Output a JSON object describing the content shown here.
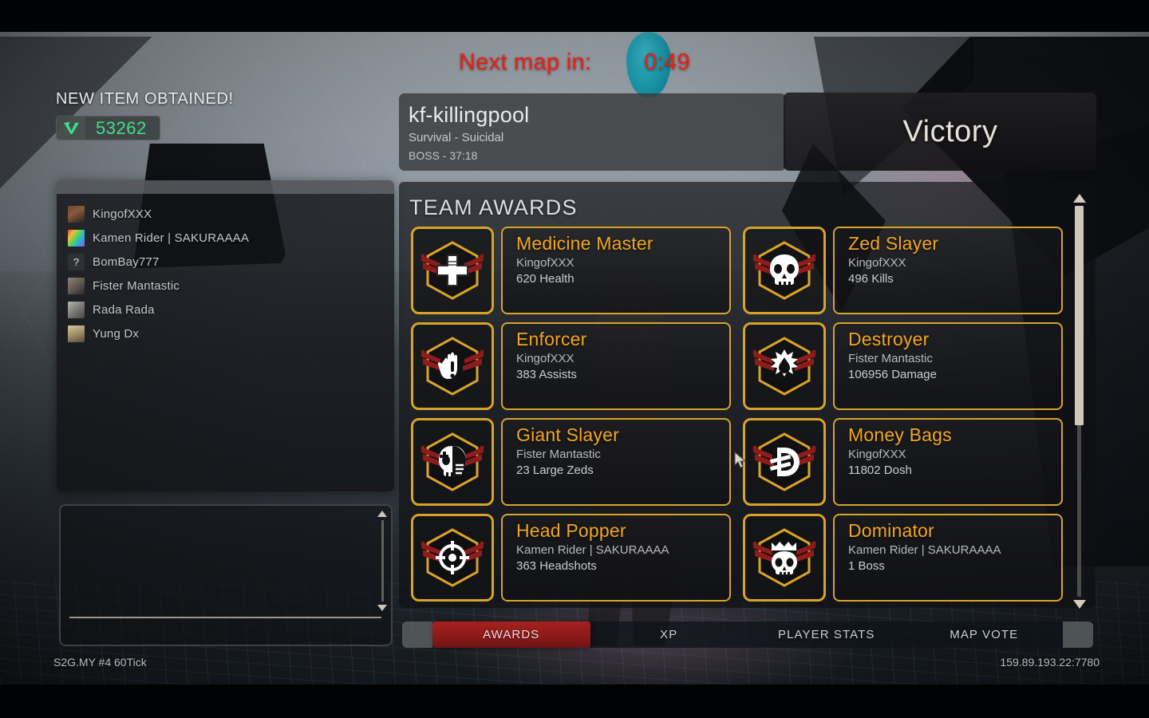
{
  "countdown": {
    "label": "Next map in:",
    "time": "0:49"
  },
  "new_item": {
    "title": "NEW ITEM OBTAINED!",
    "icon": "dosh-vault-icon",
    "value": "53262",
    "value_color": "#3ee08a"
  },
  "map_info": {
    "name": "kf-killingpool",
    "mode": "Survival - Suicidal",
    "wave": "BOSS - 37:18"
  },
  "result": {
    "text": "Victory"
  },
  "players": {
    "items": [
      {
        "name": "KingofXXX",
        "avatar": "avatar-thumbnail"
      },
      {
        "name": "Kamen Rider | SAKURAAAA",
        "avatar": "avatar-thumbnail"
      },
      {
        "name": "BomBay777",
        "avatar": "avatar-unknown-placeholder"
      },
      {
        "name": "Fister Mantastic",
        "avatar": "avatar-thumbnail"
      },
      {
        "name": "Rada Rada",
        "avatar": "avatar-thumbnail"
      },
      {
        "name": "Yung Dx",
        "avatar": "avatar-thumbnail"
      }
    ]
  },
  "awards": {
    "heading": "TEAM AWARDS",
    "accent_color": "#d9a22b",
    "name_color": "#f2a51f",
    "items": [
      {
        "name": "Medicine Master",
        "player": "KingofXXX",
        "stat": "620 Health",
        "icon": "medical-cross-icon"
      },
      {
        "name": "Zed Slayer",
        "player": "KingofXXX",
        "stat": "496 Kills",
        "icon": "skull-icon"
      },
      {
        "name": "Enforcer",
        "player": "KingofXXX",
        "stat": "383 Assists",
        "icon": "hand-exclamation-icon"
      },
      {
        "name": "Destroyer",
        "player": "Fister Mantastic",
        "stat": "106956 Damage",
        "icon": "explosion-droplet-icon"
      },
      {
        "name": "Giant Slayer",
        "player": "Fister Mantastic",
        "stat": "23 Large Zeds",
        "icon": "masked-skull-icon"
      },
      {
        "name": "Money Bags",
        "player": "KingofXXX",
        "stat": "11802 Dosh",
        "icon": "dosh-symbol-icon"
      },
      {
        "name": "Head Popper",
        "player": "Kamen Rider | SAKURAAAA",
        "stat": "363 Headshots",
        "icon": "crosshair-icon"
      },
      {
        "name": "Dominator",
        "player": "Kamen Rider | SAKURAAAA",
        "stat": "1 Boss",
        "icon": "crowned-skull-icon"
      }
    ]
  },
  "tabs": {
    "items": [
      {
        "label": "AWARDS",
        "active": true
      },
      {
        "label": "XP",
        "active": false
      },
      {
        "label": "PLAYER STATS",
        "active": false
      },
      {
        "label": "MAP VOTE",
        "active": false
      }
    ],
    "active_color": "#8c1a19"
  },
  "footer": {
    "server_name": "S2G.MY #4 60Tick",
    "server_address": "159.89.193.22:7780"
  }
}
